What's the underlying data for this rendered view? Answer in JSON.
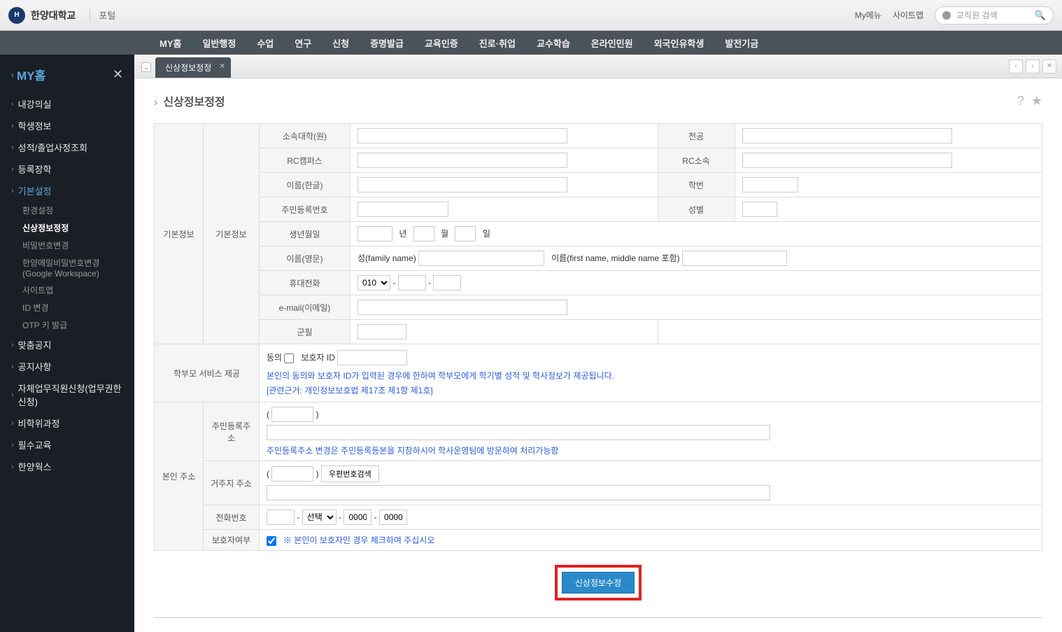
{
  "header": {
    "logo_text": "한양대학교",
    "portal": "포털",
    "right_links": [
      "My메뉴",
      "사이트맵"
    ],
    "search_placeholder": "교직원 검색"
  },
  "nav": [
    "MY홈",
    "일반행정",
    "수업",
    "연구",
    "신청",
    "증명발급",
    "교육인증",
    "진로·취업",
    "교수학습",
    "온라인민원",
    "외국인유학생",
    "발전기금"
  ],
  "sidebar": {
    "title": "MY홈",
    "items": [
      {
        "label": "내강의실",
        "type": "plain"
      },
      {
        "label": "학생정보",
        "type": "plain"
      },
      {
        "label": "성적/졸업사정조회",
        "type": "plain"
      },
      {
        "label": "등록장학",
        "type": "plain"
      },
      {
        "label": "기본설정",
        "type": "blue"
      },
      {
        "label": "환경설정",
        "type": "sub"
      },
      {
        "label": "신상정보정정",
        "type": "sub-active"
      },
      {
        "label": "비밀번호변경",
        "type": "sub"
      },
      {
        "label": "한양메일비밀번호변경(Google Workspace)",
        "type": "sub"
      },
      {
        "label": "사이트맵",
        "type": "sub"
      },
      {
        "label": "ID 변경",
        "type": "sub"
      },
      {
        "label": "OTP 키 발급",
        "type": "sub"
      },
      {
        "label": "맞춤공지",
        "type": "plain"
      },
      {
        "label": "공지사항",
        "type": "plain"
      },
      {
        "label": "자체업무직원신청(업무권한신청)",
        "type": "plain"
      },
      {
        "label": "비학위과정",
        "type": "plain"
      },
      {
        "label": "필수교육",
        "type": "plain"
      },
      {
        "label": "한양웍스",
        "type": "plain"
      }
    ]
  },
  "tab": {
    "label": "신상정보정정"
  },
  "page": {
    "title": "신상정보정정",
    "sections": {
      "basic_group": "기본정보",
      "basic_sub": "기본정보",
      "parent_svc": "학부모 서비스 제공",
      "my_addr": "본인 주소"
    },
    "labels": {
      "college": "소속대학(원)",
      "major": "전공",
      "rc_campus": "RC캠퍼스",
      "rc_belong": "RC소속",
      "name_kr": "이름(한글)",
      "student_no": "학번",
      "rrn": "주민등록번호",
      "gender": "성별",
      "birth": "생년월일",
      "year": "년",
      "month": "월",
      "day": "일",
      "name_en": "이름(영문)",
      "family_name": "성(family name)",
      "first_name": "이름(first name, middle name 포함)",
      "phone": "휴대전화",
      "phone_prefix": "010",
      "email": "e-mail(이메일)",
      "military": "군필",
      "consent": "동의",
      "guardian_id": "보호자 ID",
      "rrn_addr": "주민등록주소",
      "residence_addr": "거주지 주소",
      "zip_search": "우편번호검색",
      "phone_no": "전화번호",
      "phone_select": "선택",
      "phone_part": "0000",
      "guardian_yn": "보호자여부",
      "notes": {
        "parent1": "본인의 동의와 보호자 ID가 입력된 경우에 한하여 학부모에게 학기별 성적 및 학사정보가 제공됩니다.",
        "parent2": "[관련근거: 개인정보보호법 제17조 제1항 제1호]",
        "addr": "주민등록주소 변경은 주민등록등본을 지참하시어 학사운영팀에 방문하여 처리가능함",
        "guardian": "※ 본인이 보호자인 경우 체크하여 주십시오"
      }
    },
    "submit": "신상정보수정"
  }
}
